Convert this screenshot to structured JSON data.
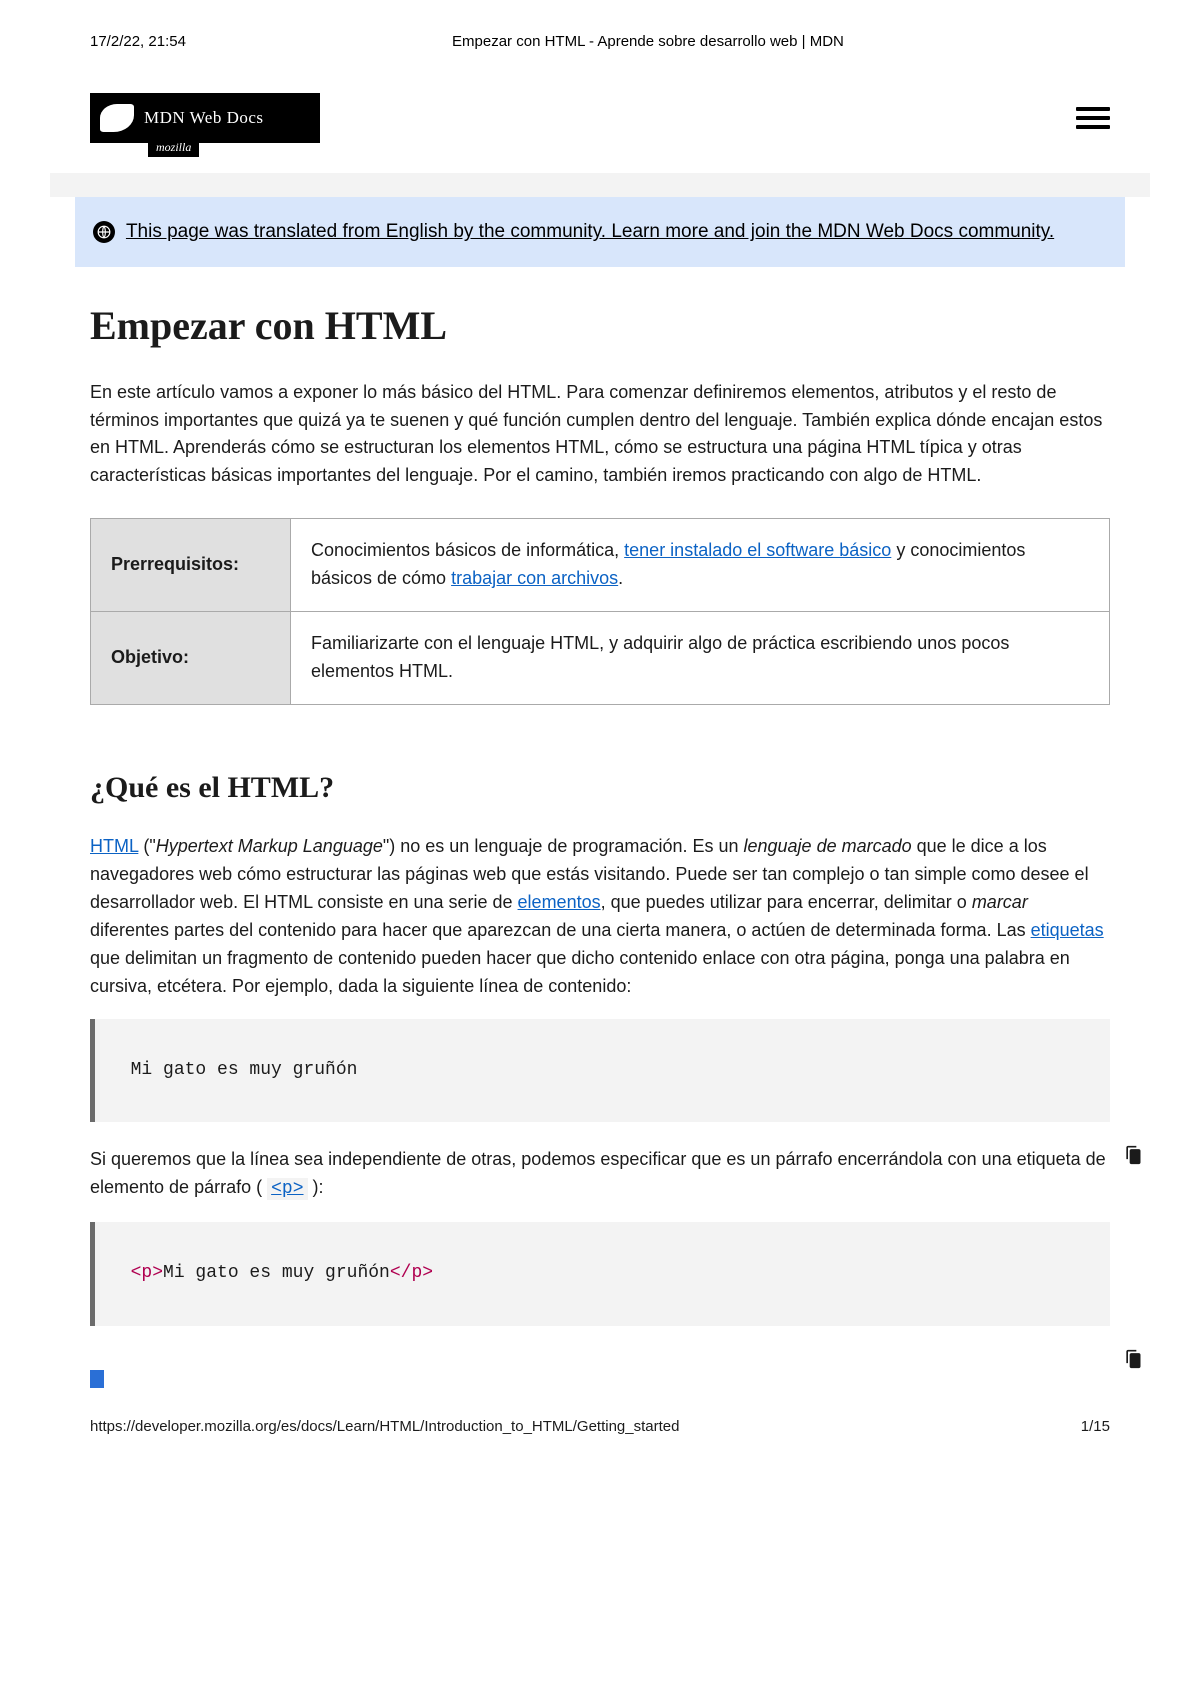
{
  "print": {
    "datetime": "17/2/22, 21:54",
    "title": "Empezar con HTML - Aprende sobre desarrollo web | MDN",
    "url": "https://developer.mozilla.org/es/docs/Learn/HTML/Introduction_to_HTML/Getting_started",
    "page": "1/15"
  },
  "header": {
    "logo_main": "MDN Web Docs",
    "logo_sub": "mozilla"
  },
  "banner": {
    "text": "This page was translated from English by the community. Learn more and join the MDN Web Docs community."
  },
  "article": {
    "title": "Empezar con HTML",
    "intro": "En este artículo vamos a exponer lo más básico del HTML. Para comenzar definiremos elementos, atributos y el resto de términos importantes que quizá ya te suenen y qué función cumplen dentro del lenguaje. También explica dónde encajan estos en HTML. Aprenderás cómo se estructuran los elementos HTML, cómo se estructura una página HTML típica y otras características básicas importantes del lenguaje. Por el camino, también iremos practicando con algo de HTML.",
    "table": {
      "row1_label": "Prerrequisitos:",
      "row1_before": "Conocimientos básicos de informática, ",
      "row1_link1": "tener instalado el software básico",
      "row1_mid": " y conocimientos básicos de cómo ",
      "row1_link2": "trabajar con archivos",
      "row1_after": ".",
      "row2_label": "Objetivo:",
      "row2_value": "Familiarizarte con el lenguaje HTML, y adquirir algo de práctica escribiendo unos pocos elementos HTML."
    },
    "section2": {
      "heading": "¿Qué es el HTML?",
      "link_html": "HTML",
      "p1_a": " (\"",
      "p1_em1": "Hypertext Markup Language",
      "p1_b": "\") no es un lenguaje de programación. Es un ",
      "p1_em2": "lenguaje de marcado",
      "p1_c": " que le dice a los navegadores web cómo estructurar las páginas web que estás visitando. Puede ser tan complejo o tan simple como desee el desarrollador web. El HTML consiste en una serie de ",
      "link_elements": "elementos",
      "p1_d": ", que puedes utilizar para encerrar, delimitar o ",
      "p1_em3": "marcar",
      "p1_e": " diferentes partes del contenido para hacer que aparezcan de una cierta manera, o actúen de determinada forma. Las ",
      "link_tags": "etiquetas",
      "p1_f": " que delimitan un fragmento de contenido pueden hacer que dicho contenido enlace con otra página, ponga una palabra en cursiva, etcétera. Por ejemplo, dada la siguiente línea de contenido:",
      "code1": "Mi gato es muy gruñón",
      "p2_a": "Si queremos que la línea sea independiente de otras, podemos especificar que es un párrafo encerrándola con una etiqueta de elemento de párrafo ( ",
      "link_p": "<p>",
      "p2_b": " ):",
      "code2_open": "<p>",
      "code2_text": "Mi gato es muy gruñón",
      "code2_close": "</p>"
    }
  }
}
